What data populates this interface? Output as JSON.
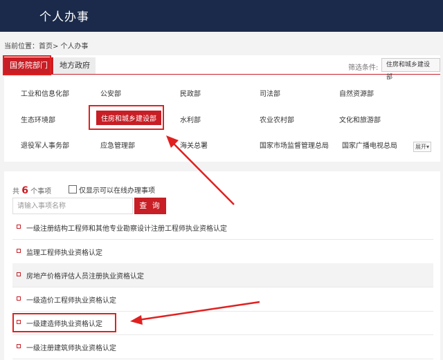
{
  "header": {
    "title": "个人办事"
  },
  "breadcrumb": {
    "text": "当前位置：首页> 个人办事"
  },
  "tabs": [
    {
      "label": "国务院部门",
      "active": true
    },
    {
      "label": "地方政府",
      "active": false
    }
  ],
  "filter": {
    "label": "筛选条件:",
    "value": "住房和城乡建设部"
  },
  "departments": [
    [
      "工业和信息化部",
      "公安部",
      "民政部",
      "司法部",
      "自然资源部"
    ],
    [
      "生态环境部",
      "住房和城乡建设部",
      "水利部",
      "农业农村部",
      "文化和旅游部"
    ],
    [
      "退役军人事务部",
      "应急管理部",
      "海关总署",
      "国家市场监督管理总局",
      "国家广播电视总局"
    ]
  ],
  "expand_label": "展开",
  "list": {
    "count_prefix": "共",
    "count": "6",
    "count_suffix": "个事项",
    "online_only_label": "仅显示可以在线办理事项",
    "search_placeholder": "请输入事项名称",
    "search_button": "查 询",
    "items": [
      "一级注册结构工程师和其他专业勘察设计注册工程师执业资格认定",
      "监理工程师执业资格认定",
      "房地产价格评估人员注册执业资格认定",
      "一级造价工程师执业资格认定",
      "一级建造师执业资格认定",
      "一级注册建筑师执业资格认定"
    ]
  },
  "colors": {
    "header_bg": "#1b2a4a",
    "accent": "#c81e25",
    "annotation": "#e02020"
  }
}
